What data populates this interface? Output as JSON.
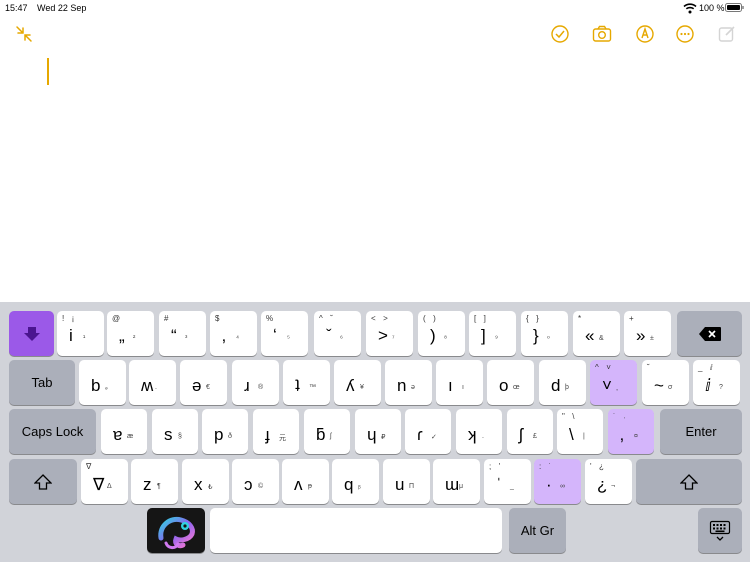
{
  "status_bar": {
    "time": "15:47",
    "date": "Wed 22 Sep",
    "battery_percent": "100 %",
    "wifi_icon": "wifi-icon",
    "battery_icon": "battery-icon"
  },
  "toolbar": {
    "left_icon": "collapse-arrows-icon",
    "right_icons": [
      "checklist-icon",
      "camera-icon",
      "markup-pen-icon",
      "more-icon",
      "compose-icon"
    ],
    "accent_color": "#e6a800"
  },
  "keyboard": {
    "colors": {
      "background": "#d1d3d9",
      "key": "#ffffff",
      "function_key": "#abafba",
      "highlight": "#d4b5fb",
      "accent": "#9b59e8"
    },
    "row1": [
      {
        "shift": "!  ¡",
        "main": "i",
        "alt": "¹"
      },
      {
        "shift": "@",
        "main": "„",
        "alt": "²"
      },
      {
        "shift": "#",
        "main": "“",
        "alt": "³"
      },
      {
        "shift": "$",
        "main": "‚",
        "alt": "⁴"
      },
      {
        "shift": "%",
        "main": "ʻ",
        "alt": "⁵"
      },
      {
        "shift": "^  ˘",
        "main": "ˇ",
        "alt": "⁶"
      },
      {
        "shift": "<  >",
        "main": ">",
        "alt": "⁷"
      },
      {
        "shift": "(  )",
        "main": ")",
        "alt": "⁸"
      },
      {
        "shift": "[  ]",
        "main": "]",
        "alt": "⁹"
      },
      {
        "shift": "{  }",
        "main": "}",
        "alt": "⁰"
      },
      {
        "shift": "*",
        "main": "«",
        "alt": "&"
      },
      {
        "shift": "+",
        "main": "»",
        "alt": "±"
      }
    ],
    "row2": [
      {
        "shift": "",
        "main": "b",
        "alt": "ₔ"
      },
      {
        "shift": "",
        "main": "ʍ",
        "alt": "."
      },
      {
        "shift": "",
        "main": "ə",
        "alt": "€"
      },
      {
        "shift": "",
        "main": "ɹ",
        "alt": "®"
      },
      {
        "shift": "",
        "main": "ʇ",
        "alt": "™"
      },
      {
        "shift": "",
        "main": "ʎ",
        "alt": "¥"
      },
      {
        "shift": "",
        "main": "n",
        "alt": "ə"
      },
      {
        "shift": "",
        "main": "ı",
        "alt": "ı"
      },
      {
        "shift": "",
        "main": "o",
        "alt": "œ"
      },
      {
        "shift": "",
        "main": "d",
        "alt": "þ"
      },
      {
        "shift": "^  ˅",
        "main": "˅",
        "alt": "˳"
      },
      {
        "shift": "˘",
        "main": "~",
        "alt": "σ"
      },
      {
        "shift": "_  ⅈ",
        "main": "ⅈ",
        "alt": "?"
      }
    ],
    "row3": [
      {
        "shift": "",
        "main": "ɐ",
        "alt": "æ"
      },
      {
        "shift": "",
        "main": "s",
        "alt": "§"
      },
      {
        "shift": "",
        "main": "p",
        "alt": "ð"
      },
      {
        "shift": "",
        "main": "ɟ",
        "alt": "元"
      },
      {
        "shift": "",
        "main": "ƃ",
        "alt": "ʃ"
      },
      {
        "shift": "",
        "main": "ɥ",
        "alt": "₽"
      },
      {
        "shift": "",
        "main": "ɾ",
        "alt": "✓"
      },
      {
        "shift": "",
        "main": "ʞ",
        "alt": "."
      },
      {
        "shift": "",
        "main": "ʃ",
        "alt": "£"
      },
      {
        "shift": "\"  \\",
        "main": "\\",
        "alt": "|"
      },
      {
        "shift": "˙  ˒",
        "main": "‚",
        "alt": "¤"
      }
    ],
    "row4": [
      {
        "shift": "∇",
        "main": "∇",
        "alt": "Δ"
      },
      {
        "shift": "",
        "main": "z",
        "alt": "¶"
      },
      {
        "shift": "",
        "main": "x",
        "alt": "₺"
      },
      {
        "shift": "",
        "main": "ɔ",
        "alt": "©"
      },
      {
        "shift": "",
        "main": "ʌ",
        "alt": "ᵽ"
      },
      {
        "shift": "",
        "main": "q",
        "alt": "ᵦ"
      },
      {
        "shift": "",
        "main": "u",
        "alt": "П"
      },
      {
        "shift": "",
        "main": "ɯ",
        "alt": "μ"
      },
      {
        "shift": ";  '",
        "main": "ˈ",
        "alt": "_"
      },
      {
        "shift": ":  ˙",
        "main": "·",
        "alt": "∞"
      },
      {
        "shift": "'  ¿",
        "main": "¿",
        "alt": "¬"
      }
    ],
    "labels": {
      "tab": "Tab",
      "caps_lock": "Caps Lock",
      "enter": "Enter",
      "alt_gr": "Alt Gr"
    },
    "icons": {
      "language": "down-arrow-icon",
      "backspace": "backspace-icon",
      "shift": "shift-arrow-icon",
      "app": "chameleon-logo-icon",
      "dismiss": "keyboard-dismiss-icon"
    }
  }
}
